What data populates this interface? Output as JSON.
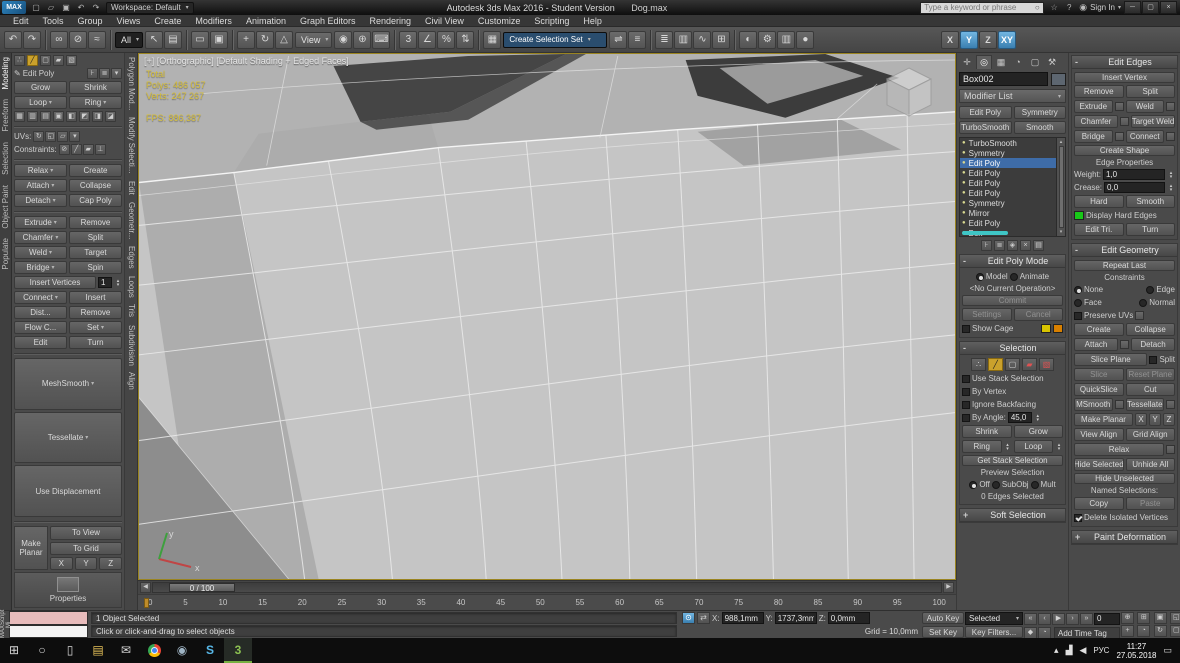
{
  "glyphs": {
    "dd": "▾",
    "up": "▴",
    "down": "▾",
    "minus": "-",
    "plus": "+",
    "bulb": "●",
    "left": "◀",
    "right": "▶"
  },
  "titlebar": {
    "logo": "MAX",
    "quick_icons": [
      {
        "name": "new-scene-icon",
        "glyph": "▢"
      },
      {
        "name": "open-file-icon",
        "glyph": "▱"
      },
      {
        "name": "save-file-icon",
        "glyph": "▣"
      },
      {
        "name": "undo-quick-icon",
        "glyph": "↶"
      },
      {
        "name": "redo-quick-icon",
        "glyph": "↷"
      }
    ],
    "workspace": "Workspace: Default",
    "title": "Autodesk 3ds Max 2016 - Student Version",
    "filename": "Dog.max",
    "search_placeholder": "Type a keyword or phrase",
    "search_icon": "○",
    "infocenter_icons": [
      {
        "name": "infocenter-star-icon",
        "glyph": "☆"
      },
      {
        "name": "infocenter-help-icon",
        "glyph": "?"
      }
    ],
    "user_icon": "◉",
    "sign_in": "Sign In",
    "window_controls": [
      {
        "name": "minimize-button",
        "glyph": "─"
      },
      {
        "name": "maximize-button",
        "glyph": "▢"
      },
      {
        "name": "close-button",
        "glyph": "×"
      }
    ]
  },
  "menubar": {
    "items": [
      "Edit",
      "Tools",
      "Group",
      "Views",
      "Create",
      "Modifiers",
      "Animation",
      "Graph Editors",
      "Rendering",
      "Civil View",
      "Customize",
      "Scripting",
      "Help"
    ]
  },
  "toolbar": {
    "history": [
      {
        "name": "undo-icon",
        "glyph": "↶"
      },
      {
        "name": "redo-icon",
        "glyph": "↷"
      }
    ],
    "links": [
      {
        "name": "select-and-link-icon",
        "glyph": "∞"
      },
      {
        "name": "unlink-selection-icon",
        "glyph": "⊘"
      },
      {
        "name": "bind-to-space-warp-icon",
        "glyph": "≈"
      }
    ],
    "filter_value": "All",
    "select": [
      {
        "name": "select-object-icon",
        "glyph": "↖"
      },
      {
        "name": "select-by-name-icon",
        "glyph": "▤"
      }
    ],
    "region": [
      {
        "name": "rectangular-selection-region-icon",
        "glyph": "▭"
      },
      {
        "name": "window-crossing-toggle-icon",
        "glyph": "▣"
      }
    ],
    "transform": [
      {
        "name": "select-and-move-icon",
        "glyph": "+"
      },
      {
        "name": "select-and-rotate-icon",
        "glyph": "↻"
      },
      {
        "name": "select-and-scale-icon",
        "glyph": "△"
      }
    ],
    "view_value": "View",
    "pivot": [
      {
        "name": "use-pivot-point-icon",
        "glyph": "◉"
      },
      {
        "name": "select-and-manipulate-icon",
        "glyph": "⊕"
      },
      {
        "name": "keyboard-shortcut-override-icon",
        "glyph": "⌨"
      }
    ],
    "snaps": [
      {
        "name": "snap-toggle-3d-icon",
        "glyph": "3"
      },
      {
        "name": "angle-snap-icon",
        "glyph": "∠"
      },
      {
        "name": "percent-snap-icon",
        "glyph": "%"
      },
      {
        "name": "spinner-snap-icon",
        "glyph": "⇅"
      }
    ],
    "sets_icon": {
      "glyph": "▦"
    },
    "selection_set_value": "Create Selection Set",
    "mirror_align": [
      {
        "name": "mirror-icon",
        "glyph": "⇌"
      },
      {
        "name": "align-icon",
        "glyph": "≡"
      }
    ],
    "managers": [
      {
        "name": "layer-manager-icon",
        "glyph": "≣"
      },
      {
        "name": "ribbon-toggle-icon",
        "glyph": "▥"
      },
      {
        "name": "curve-editor-icon",
        "glyph": "∿"
      },
      {
        "name": "schematic-view-icon",
        "glyph": "⊞"
      }
    ],
    "render": [
      {
        "name": "material-editor-icon",
        "glyph": "◐"
      },
      {
        "name": "render-setup-icon",
        "glyph": "⚙"
      },
      {
        "name": "rendered-frame-window-icon",
        "glyph": "▥"
      },
      {
        "name": "render-production-icon",
        "glyph": "●"
      }
    ],
    "axis": [
      {
        "name": "axis-x-toggle",
        "label": "X"
      },
      {
        "name": "axis-y-toggle",
        "label": "Y",
        "active": true
      },
      {
        "name": "axis-z-toggle",
        "label": "Z"
      },
      {
        "name": "axis-xy-toggle",
        "label": "XY",
        "active": true
      }
    ]
  },
  "ribbon": {
    "tabs": [
      {
        "name": "ribbon-tab-modeling",
        "label": "Modeling",
        "active": true
      },
      {
        "name": "ribbon-tab-freeform",
        "label": "Freeform"
      },
      {
        "name": "ribbon-tab-selection",
        "label": "Selection"
      },
      {
        "name": "ribbon-tab-object-paint",
        "label": "Object Paint"
      },
      {
        "name": "ribbon-tab-populate",
        "label": "Populate"
      }
    ]
  },
  "panel_tabs": [
    {
      "name": "panel-tab-polygon-modeling",
      "label": "Polygon Mod..."
    },
    {
      "name": "panel-tab-modify-selection",
      "label": "Modify Selecti..."
    },
    {
      "name": "panel-tab-edit",
      "label": "Edit"
    },
    {
      "name": "panel-tab-geometry",
      "label": "Geometr..."
    },
    {
      "name": "panel-tab-edges",
      "label": "Edges"
    },
    {
      "name": "panel-tab-loops",
      "label": "Loops"
    },
    {
      "name": "panel-tab-tris",
      "label": "Tris"
    },
    {
      "name": "panel-tab-subdivision",
      "label": "Subdivision"
    },
    {
      "name": "panel-tab-align",
      "label": "Align"
    }
  ],
  "left_panel": {
    "subobject_icons": [
      {
        "name": "vertex-mode-icon",
        "glyph": "∴"
      },
      {
        "name": "edge-mode-icon",
        "glyph": "╱",
        "active": true
      },
      {
        "name": "border-mode-icon",
        "glyph": "▢"
      },
      {
        "name": "polygon-mode-icon",
        "glyph": "▰"
      },
      {
        "name": "element-mode-icon",
        "glyph": "▧"
      }
    ],
    "pencil_icon": "✎",
    "edit_poly_label": "Edit Poly",
    "side_icons": [
      {
        "name": "pin-stack-mini-icon",
        "glyph": "⊦"
      },
      {
        "name": "show-end-result-mini-icon",
        "glyph": "≣"
      },
      {
        "name": "collapse-stack-mini-icon",
        "glyph": "▾"
      }
    ],
    "grow": "Grow",
    "shrink": "Shrink",
    "loop": "Loop",
    "ring": "Ring",
    "loop_tools": [
      {
        "name": "grow-loop-icon",
        "glyph": "▦"
      },
      {
        "name": "shrink-loop-icon",
        "glyph": "▥"
      },
      {
        "name": "insert-loop-icon",
        "glyph": "▤"
      },
      {
        "name": "remove-loop-icon",
        "glyph": "▣"
      },
      {
        "name": "build-end-icon",
        "glyph": "◧"
      },
      {
        "name": "build-corner-icon",
        "glyph": "◩"
      },
      {
        "name": "auto-loop-icon",
        "glyph": "◨"
      },
      {
        "name": "auto-ring-icon",
        "glyph": "◪"
      }
    ],
    "uvs_label": "UVs:",
    "uvs_icons": [
      {
        "name": "tweak-uv-icon",
        "glyph": "↻"
      },
      {
        "name": "peel-uv-icon",
        "glyph": "◱"
      },
      {
        "name": "unwrap-uvw-icon",
        "glyph": "▱"
      },
      {
        "name": "uv-dropdown-icon",
        "glyph": "▾"
      }
    ],
    "constraints_label": "Constraints:",
    "constraint_icons": [
      {
        "name": "constraint-none-icon",
        "glyph": "⊘"
      },
      {
        "name": "constraint-edge-icon",
        "glyph": "╱"
      },
      {
        "name": "constraint-face-icon",
        "glyph": "▰"
      },
      {
        "name": "constraint-normal-icon",
        "glyph": "⊥"
      }
    ],
    "relax": "Relax",
    "create": "Create",
    "attach": "Attach",
    "collapse": "Collapse",
    "detach": "Detach",
    "cap_poly": "Cap Poly",
    "extrude": "Extrude",
    "remove": "Remove",
    "chamfer": "Chamfer",
    "split": "Split",
    "weld": "Weld",
    "target": "Target",
    "bridge": "Bridge",
    "spin": "Spin",
    "insert_vertices": "Insert Vertices",
    "insert_value": "1",
    "connect": "Connect",
    "insert": "Insert",
    "dist": "Dist...",
    "remove2": "Remove",
    "flow": "Flow C...",
    "set": "Set",
    "edit": "Edit",
    "turn": "Turn",
    "meshsmooth": "MeshSmooth",
    "tessellate": "Tessellate",
    "use_displacement": "Use Displacement",
    "make_planar": "Make Planar",
    "to_view": "To View",
    "to_grid": "To Grid",
    "axes": [
      {
        "name": "make-planar-x-button",
        "label": "X"
      },
      {
        "name": "make-planar-y-button",
        "label": "Y"
      },
      {
        "name": "make-planar-z-button",
        "label": "Z"
      }
    ],
    "properties": "Properties"
  },
  "viewport": {
    "label": "[+] [Orthographic] [Default Shading + Edged Faces]",
    "stats_total": "Total",
    "stats_polys": "Polys: 486 057",
    "stats_verts": "Verts: 247 267",
    "stats_fps": "FPS: 886,387",
    "axis_x": "x",
    "axis_y": "y"
  },
  "timeline": {
    "slider": "0 / 100",
    "ticks": [
      "0",
      "5",
      "10",
      "15",
      "20",
      "25",
      "30",
      "35",
      "40",
      "45",
      "50",
      "55",
      "60",
      "65",
      "70",
      "75",
      "80",
      "85",
      "90",
      "95",
      "100"
    ]
  },
  "command_panel": {
    "tabs": [
      {
        "name": "create-tab-icon",
        "glyph": "✛"
      },
      {
        "name": "modify-tab-icon",
        "glyph": "◎",
        "active": true
      },
      {
        "name": "hierarchy-tab-icon",
        "glyph": "▦"
      },
      {
        "name": "motion-tab-icon",
        "glyph": "◔"
      },
      {
        "name": "display-tab-icon",
        "glyph": "▢"
      },
      {
        "name": "utilities-tab-icon",
        "glyph": "⚒"
      }
    ],
    "object_name": "Box002",
    "modifier_list": "Modifier List",
    "modifier_sets": [
      "Edit Poly",
      "Symmetry",
      "TurboSmooth",
      "Smooth"
    ],
    "stack": [
      {
        "label": "TurboSmooth"
      },
      {
        "label": "Symmetry"
      },
      {
        "label": "Edit Poly",
        "selected": true
      },
      {
        "label": "Edit Poly"
      },
      {
        "label": "Edit Poly"
      },
      {
        "label": "Edit Poly"
      },
      {
        "label": "Symmetry"
      },
      {
        "label": "Mirror"
      },
      {
        "label": "Edit Poly"
      },
      {
        "label": "Box"
      }
    ],
    "stack_tools": [
      {
        "name": "pin-stack-icon",
        "glyph": "⊦"
      },
      {
        "name": "show-end-result-icon",
        "glyph": "≣"
      },
      {
        "name": "make-unique-icon",
        "glyph": "◈"
      },
      {
        "name": "remove-modifier-icon",
        "glyph": "×"
      },
      {
        "name": "configure-modifier-sets-icon",
        "glyph": "▤"
      }
    ],
    "epm": {
      "title": "Edit Poly Mode",
      "model": "Model",
      "animate": "Animate",
      "noop": "<No Current Operation>",
      "commit": "Commit",
      "settings": "Settings",
      "cancel": "Cancel",
      "show_cage": "Show Cage"
    },
    "sel": {
      "title": "Selection",
      "icons": [
        {
          "name": "vertex-subobject-icon",
          "glyph": "∴"
        },
        {
          "name": "edge-subobject-icon",
          "glyph": "╱",
          "active": true
        },
        {
          "name": "border-subobject-icon",
          "glyph": "▢"
        },
        {
          "name": "polygon-subobject-icon",
          "glyph": "▰",
          "red": true
        },
        {
          "name": "element-subobject-icon",
          "glyph": "▧",
          "red": true
        }
      ],
      "use_stack": "Use Stack Selection",
      "by_vertex": "By Vertex",
      "ignore_backfacing": "Ignore Backfacing",
      "by_angle": "By Angle:",
      "angle_value": "45,0",
      "shrink": "Shrink",
      "grow": "Grow",
      "ring": "Ring",
      "loop": "Loop",
      "get_stack": "Get Stack Selection",
      "preview": "Preview Selection",
      "off": "Off",
      "subobj": "SubObj",
      "mult": "Mult",
      "status": "0 Edges Selected"
    },
    "soft": {
      "title": "Soft Selection"
    }
  },
  "edit_edges": {
    "title": "Edit Edges",
    "insert_vertex": "Insert Vertex",
    "remove": "Remove",
    "split": "Split",
    "extrude": "Extrude",
    "weld": "Weld",
    "chamfer": "Chamfer",
    "target_weld": "Target Weld",
    "bridge": "Bridge",
    "connect": "Connect",
    "create_shape": "Create Shape",
    "props": "Edge Properties",
    "weight": "Weight:",
    "weight_value": "1,0",
    "crease": "Crease:",
    "crease_value": "0,0",
    "hard": "Hard",
    "smooth": "Smooth",
    "display_hard": "Display Hard Edges",
    "edit_tri": "Edit Tri.",
    "turn": "Turn"
  },
  "edit_geometry": {
    "title": "Edit Geometry",
    "repeat_last": "Repeat Last",
    "constraints": "Constraints",
    "none": "None",
    "edge": "Edge",
    "face": "Face",
    "normal": "Normal",
    "preserve_uvs": "Preserve UVs",
    "create": "Create",
    "collapse": "Collapse",
    "attach": "Attach",
    "detach": "Detach",
    "slice_plane": "Slice Plane",
    "split": "Split",
    "slice": "Slice",
    "reset_plane": "Reset Plane",
    "quickslice": "QuickSlice",
    "cut": "Cut",
    "msmooth": "MSmooth",
    "tessellate": "Tessellate",
    "make_planar": "Make Planar",
    "x": "X",
    "y": "Y",
    "z": "Z",
    "view_align": "View Align",
    "grid_align": "Grid Align",
    "relax": "Relax",
    "hide_selected": "Hide Selected",
    "unhide_all": "Unhide All",
    "hide_unselected": "Hide Unselected",
    "named_sel": "Named Selections:",
    "copy": "Copy",
    "paste": "Paste",
    "delete_isolated": "Delete Isolated Vertices"
  },
  "paint_deformation": {
    "title": "Paint Deformation"
  },
  "statusbar": {
    "maxscript": "MAXScript Mi",
    "selected": "1 Object Selected",
    "prompt": "Click or click-and-drag to select objects",
    "x_label": "X:",
    "x_value": "988,1mm",
    "y_label": "Y:",
    "y_value": "1737,3mm",
    "z_label": "Z:",
    "z_value": "0,0mm",
    "grid": "Grid = 10,0mm",
    "add_time_tag": "Add Time Tag"
  },
  "animation": {
    "auto_key": "Auto Key",
    "set_key": "Set Key",
    "selected": "Selected",
    "key_filters": "Key Filters...",
    "time_value": "0",
    "transport": [
      {
        "name": "go-to-start-icon",
        "glyph": "«"
      },
      {
        "name": "previous-frame-icon",
        "glyph": "‹"
      },
      {
        "name": "play-animation-icon",
        "glyph": "▶"
      },
      {
        "name": "next-frame-icon",
        "glyph": "›"
      },
      {
        "name": "go-to-end-icon",
        "glyph": "»"
      }
    ],
    "extra": [
      {
        "name": "key-mode-toggle-icon",
        "glyph": "◆"
      },
      {
        "name": "time-configuration-icon",
        "glyph": "◔"
      }
    ],
    "nav": [
      {
        "name": "zoom-icon",
        "glyph": "⊕"
      },
      {
        "name": "zoom-all-icon",
        "glyph": "⊞"
      },
      {
        "name": "zoom-extents-icon",
        "glyph": "▣"
      },
      {
        "name": "zoom-region-icon",
        "glyph": "◱"
      },
      {
        "name": "pan-icon",
        "glyph": "+"
      },
      {
        "name": "field-of-view-icon",
        "glyph": "◔"
      },
      {
        "name": "orbit-icon",
        "glyph": "↻"
      },
      {
        "name": "maximize-viewport-icon",
        "glyph": "▢"
      }
    ]
  },
  "taskbar": {
    "start": "⊞",
    "search": "○",
    "task_view": "▯",
    "explorer": "▤",
    "mail": "✉",
    "steam": "◉",
    "skype": "S",
    "max": "3",
    "tray_expand": "▴",
    "network": "▟",
    "volume": "◀",
    "action_center": "▭",
    "lang": "РУС",
    "time": "11:27",
    "date": "27.05.2018"
  }
}
